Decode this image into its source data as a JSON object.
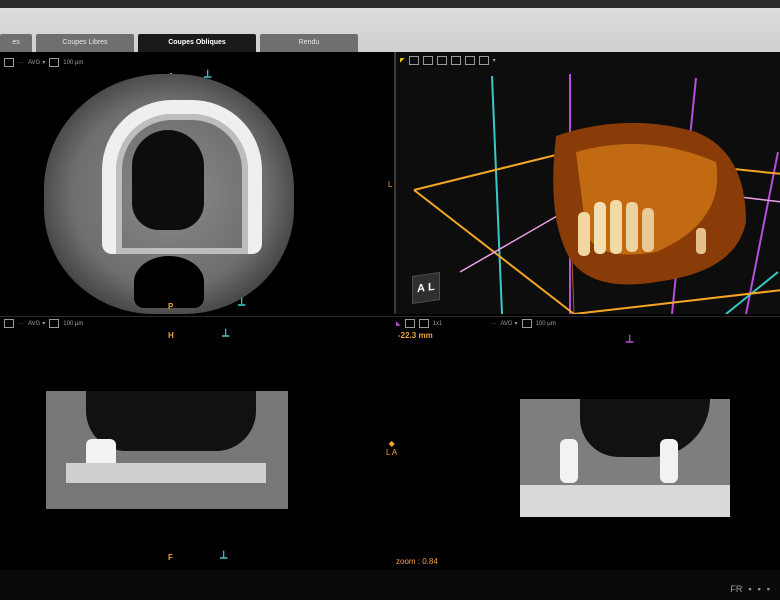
{
  "tabs": [
    {
      "label": "es"
    },
    {
      "label": "Coupes Libres"
    },
    {
      "label": "Coupes Obliques"
    },
    {
      "label": "Rendu"
    }
  ],
  "active_tab": "Coupes Obliques",
  "viewer": {
    "avg_label": "AVG",
    "thickness": "100 µm",
    "offset_3d": "-22.3 mm",
    "ratio": "1x1",
    "zoom_label": "zoom : 0.84"
  },
  "orientation": {
    "axial": {
      "top": "A",
      "bottom": "P"
    },
    "coronal": {
      "top": "H",
      "bottom": "F",
      "center": "L A"
    },
    "left_marker": "L"
  },
  "cube": {
    "left": "A",
    "right": "L"
  },
  "colors": {
    "orientation": "#f2a33a",
    "slice_cyan": "#39c7c7",
    "slice_magenta": "#c04bd8",
    "render_box": "#f5a623"
  },
  "taskbar": {
    "items": [
      "FR"
    ]
  }
}
